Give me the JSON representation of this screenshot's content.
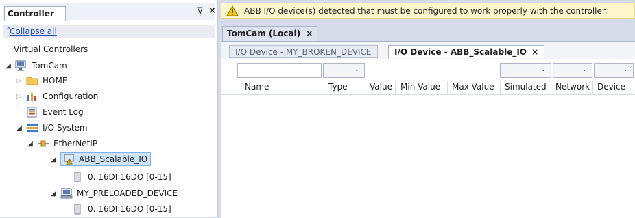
{
  "left_pane": {
    "tab_label": "Controller",
    "pin_glyph": "⊽",
    "close_glyph": "×",
    "collapse_icon": "^",
    "collapse_label": "Collapse all",
    "tree_title": "Virtual Controllers",
    "tree": [
      {
        "label": "TomCam",
        "icon": "controller-icon",
        "expander": "◢"
      },
      {
        "label": "HOME",
        "icon": "folder-icon",
        "expander": "▷"
      },
      {
        "label": "Configuration",
        "icon": "configuration-icon",
        "expander": "▷"
      },
      {
        "label": "Event Log",
        "icon": "event-log-icon",
        "expander": ""
      },
      {
        "label": "I/O System",
        "icon": "io-system-icon",
        "expander": "◢"
      },
      {
        "label": "EtherNetIP",
        "icon": "ethernet-ip-icon",
        "expander": "◢"
      },
      {
        "label": "ABB_Scalable_IO",
        "icon": "device-warning-icon",
        "expander": "◢"
      },
      {
        "label": "0. 16DI:16DO  [0-15]",
        "icon": "io-module-icon",
        "expander": ""
      },
      {
        "label": "MY_PRELOADED_DEVICE",
        "icon": "device-icon",
        "expander": "◢"
      },
      {
        "label": "0. 16DI:16DO  [0-15]",
        "icon": "io-module-icon",
        "expander": ""
      }
    ]
  },
  "warning": {
    "icon": "warning-icon",
    "text": "ABB I/O device(s) detected that must be configured to work properly with the controller."
  },
  "doc_tab": {
    "label": "TomCam (Local)",
    "close": "×"
  },
  "sub_tabs": [
    {
      "label": "I/O Device - MY_BROKEN_DEVICE"
    },
    {
      "label": "I/O Device - ABB_Scalable_IO",
      "close": "×"
    }
  ],
  "filters": {
    "chevron": "⌄"
  },
  "columns": [
    "Name",
    "Type",
    "Value",
    "Min Value",
    "Max Value",
    "Simulated",
    "Network",
    "Device"
  ],
  "colors": {
    "selection": "#cfe5fb",
    "warning_bg": "#fff7cc",
    "link": "#1f4fc0"
  }
}
